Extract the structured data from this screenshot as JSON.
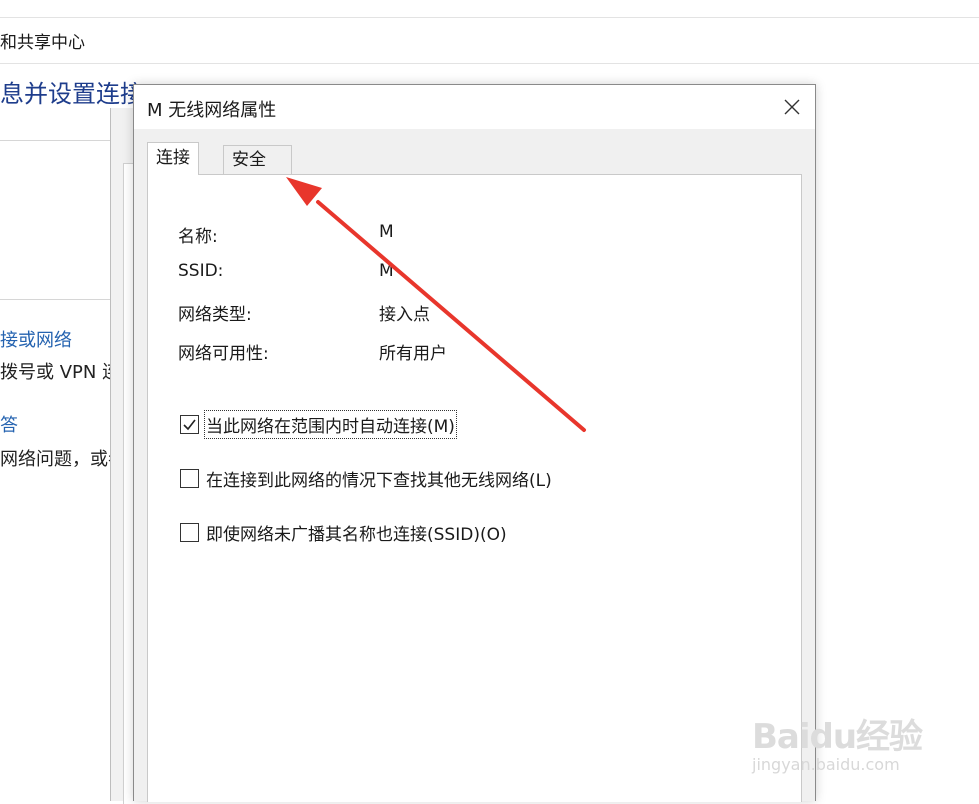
{
  "background": {
    "breadcrumb": "和共享中心",
    "heading": "息并设置连接",
    "link1": "接或网络",
    "text1": "拨号或 VPN 连接",
    "link2": "答",
    "text2": "网络问题，或者"
  },
  "dialog": {
    "title": "M 无线网络属性",
    "tabs": [
      {
        "label": "连接",
        "selected": true
      },
      {
        "label": "安全",
        "selected": false
      }
    ],
    "properties": [
      {
        "label": "名称:",
        "value": "M"
      },
      {
        "label": "SSID:",
        "value": "M"
      },
      {
        "label": "网络类型:",
        "value": "接入点"
      },
      {
        "label": "网络可用性:",
        "value": "所有用户"
      }
    ],
    "options": [
      {
        "label": "当此网络在范围内时自动连接(M)",
        "checked": true
      },
      {
        "label": "在连接到此网络的情况下查找其他无线网络(L)",
        "checked": false
      },
      {
        "label": "即使网络未广播其名称也连接(SSID)(O)",
        "checked": false
      }
    ]
  },
  "annotation": {
    "color": "#e8362c"
  },
  "watermark": {
    "logo": "Baidu经验",
    "url": "jingyan.baidu.com"
  }
}
